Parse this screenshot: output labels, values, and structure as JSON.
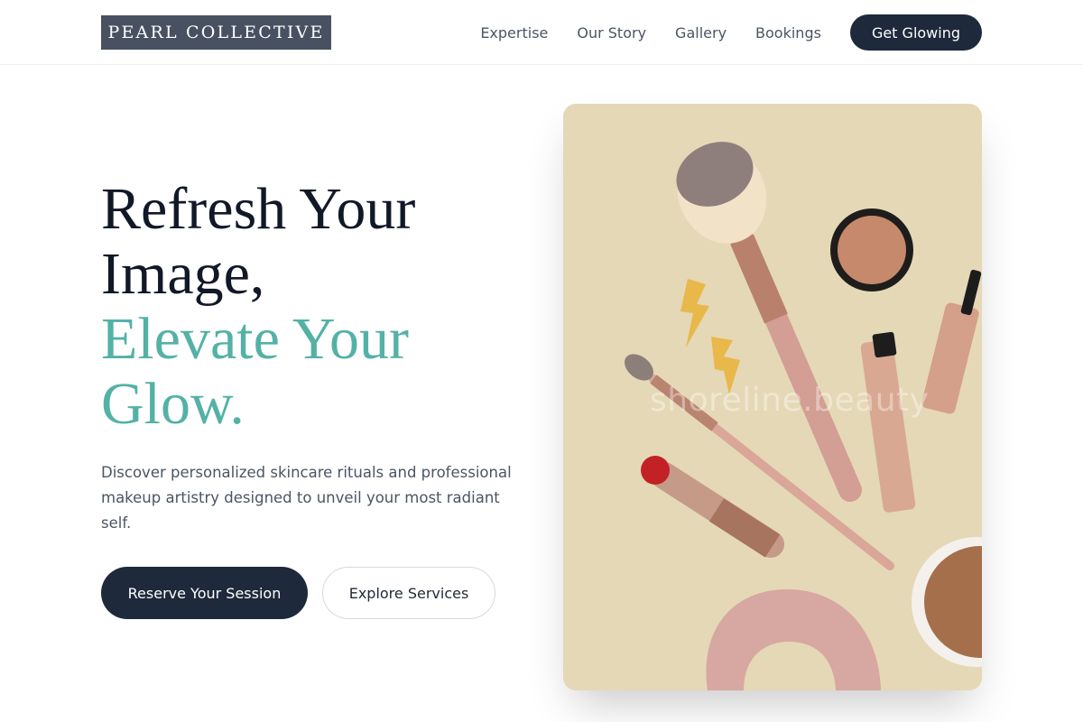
{
  "header": {
    "logo": "PEARL COLLECTIVE",
    "nav": [
      "Expertise",
      "Our Story",
      "Gallery",
      "Bookings"
    ],
    "cta": "Get Glowing"
  },
  "hero": {
    "headline": {
      "line1": "Refresh Your",
      "line2": "Image,",
      "line3": "Elevate Your",
      "line4": "Glow."
    },
    "lead": "Discover personalized skincare rituals and professional makeup artistry designed to unveil your most radiant self.",
    "primary_button": "Reserve Your Session",
    "secondary_button": "Explore Services",
    "image": {
      "watermark": "shoreline.beauty",
      "subject": "makeup brushes, lipstick, mascara, compacts and a velvet scrunchie on a beige background",
      "background_color": "#e5d8b6",
      "accent_color": "#54b1a6"
    }
  }
}
